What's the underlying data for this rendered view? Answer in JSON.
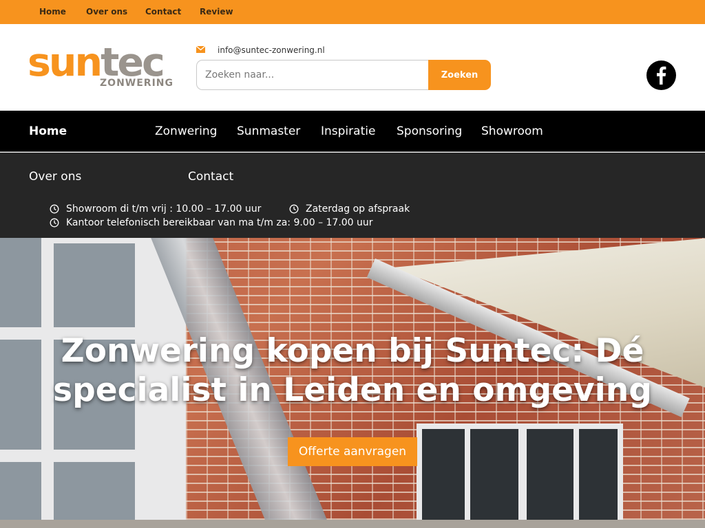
{
  "topbar": {
    "links": [
      "Home",
      "Over ons",
      "Contact",
      "Review"
    ]
  },
  "header": {
    "logo_main_1": "sun",
    "logo_main_2": "tec",
    "logo_sub": "ZONWERING",
    "email": "info@suntec-zonwering.nl",
    "email_icon": "envelope-icon",
    "search_placeholder": "Zoeken naar...",
    "search_button": "Zoeken",
    "social_icon": "facebook-icon"
  },
  "nav": {
    "items": [
      "Home",
      "Zonwering",
      "Sunmaster",
      "Inspiratie",
      "Sponsoring",
      "Showroom"
    ],
    "active": "Home"
  },
  "subnav": {
    "items": [
      "Over ons",
      "Contact"
    ]
  },
  "hours": {
    "icon": "clock-icon",
    "showroom": "Showroom di t/m vrij : 10.00 – 17.00 uur",
    "saturday": "Zaterdag op afspraak",
    "office": "Kantoor telefonisch bereikbaar van ma t/m za: 9.00 – 17.00 uur"
  },
  "hero": {
    "title": "Zonwering kopen bij Suntec: Dé specialist in Leiden en omgeving",
    "button": "Offerte aanvragen"
  },
  "colors": {
    "accent": "#f7931e",
    "nav_bg": "#000000",
    "band_bg": "#262626",
    "logo_grey": "#9a948d"
  }
}
